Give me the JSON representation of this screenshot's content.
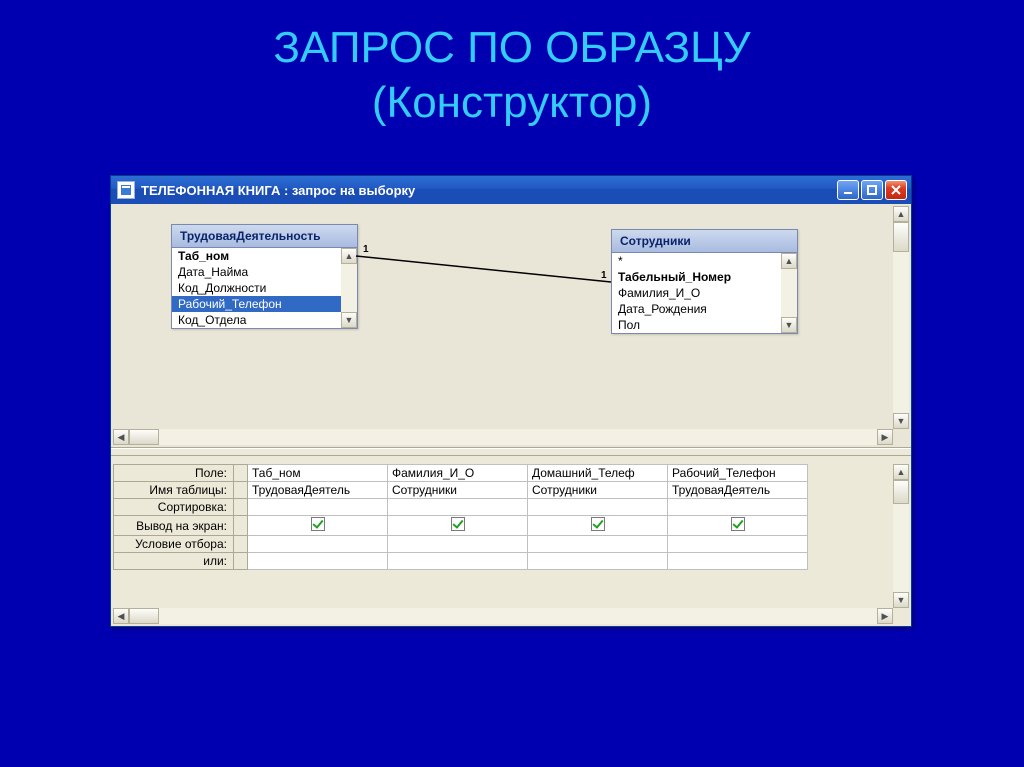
{
  "slide": {
    "title_line1": "ЗАПРОС ПО ОБРАЗЦУ",
    "title_line2": "(Конструктор)"
  },
  "window": {
    "title": "ТЕЛЕФОННАЯ КНИГА : запрос на выборку"
  },
  "relationship": {
    "left_label": "1",
    "right_label": "1"
  },
  "tables": {
    "left": {
      "name": "ТрудоваяДеятельность",
      "fields": [
        "Таб_ном",
        "Дата_Найма",
        "Код_Должности",
        "Рабочий_Телефон",
        "Код_Отдела"
      ],
      "bold_index": 0,
      "selected_index": 3
    },
    "right": {
      "name": "Сотрудники",
      "fields": [
        "*",
        "Табельный_Номер",
        "Фамилия_И_О",
        "Дата_Рождения",
        "Пол"
      ],
      "bold_index": 1,
      "selected_index": -1
    }
  },
  "grid": {
    "row_labels": [
      "Поле:",
      "Имя таблицы:",
      "Сортировка:",
      "Вывод на экран:",
      "Условие отбора:",
      "или:"
    ],
    "columns": [
      {
        "field": "Таб_ном",
        "table": "ТрудоваяДеятель",
        "sort": "",
        "show": true,
        "criteria": "",
        "or": ""
      },
      {
        "field": "Фамилия_И_О",
        "table": "Сотрудники",
        "sort": "",
        "show": true,
        "criteria": "",
        "or": ""
      },
      {
        "field": "Домашний_Телеф",
        "table": "Сотрудники",
        "sort": "",
        "show": true,
        "criteria": "",
        "or": ""
      },
      {
        "field": "Рабочий_Телефон",
        "table": "ТрудоваяДеятель",
        "sort": "",
        "show": true,
        "criteria": "",
        "or": ""
      }
    ]
  }
}
